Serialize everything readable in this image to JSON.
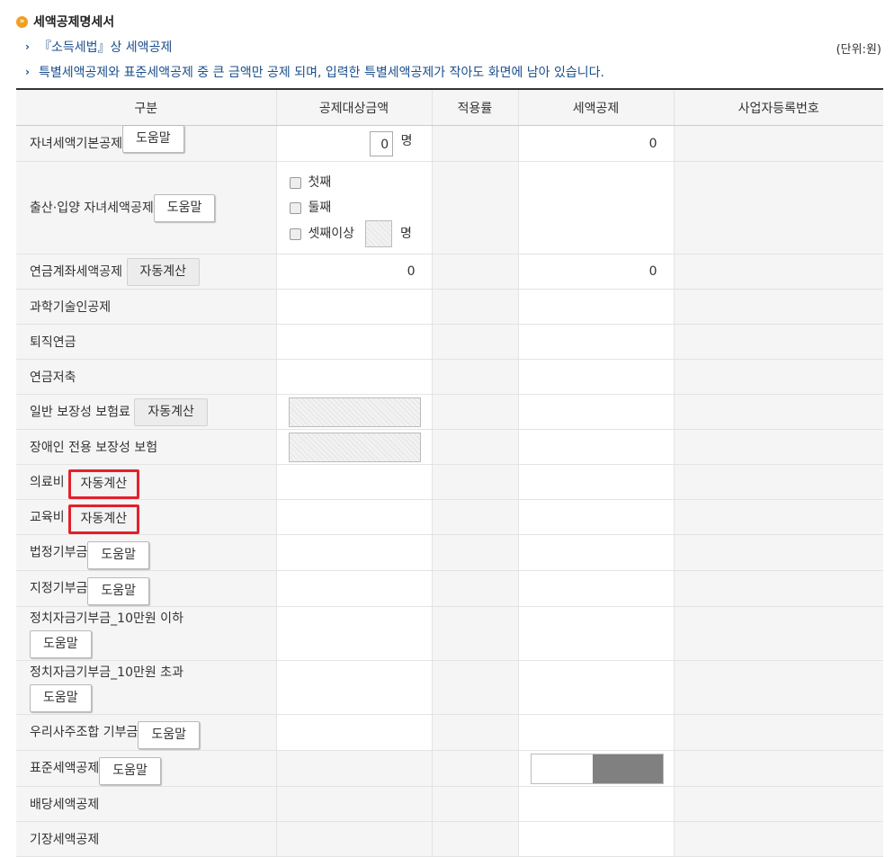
{
  "header": {
    "bullet": "»",
    "title": "세액공제명세서"
  },
  "notes": {
    "arrow": "›",
    "line1": "『소득세법』상 세액공제",
    "line2": "특별세액공제와 표준세액공제 중 큰 금액만 공제 되며, 입력한 특별세액공제가 작아도 화면에 남아 있습니다."
  },
  "unit": "(단위:원)",
  "columns": [
    "구분",
    "공제대상금액",
    "적용률",
    "세액공제",
    "사업자등록번호"
  ],
  "rows": {
    "child_basic": {
      "label": "자녀세액기본공제",
      "button": "도움말",
      "count": "0",
      "count_unit": "명",
      "credit": "0"
    },
    "birth_adoption": {
      "label": "출산·입양 자녀세액공제",
      "button": "도움말",
      "options": [
        "첫째",
        "둘째",
        "셋째이상"
      ],
      "count_unit": "명"
    },
    "pension_account": {
      "label": "연금계좌세액공제",
      "button": "자동계산",
      "amount": "0",
      "credit": "0"
    },
    "sci_tech": {
      "label": "과학기술인공제"
    },
    "retirement": {
      "label": "퇴직연금"
    },
    "pension_savings": {
      "label": "연금저축"
    },
    "general_insurance": {
      "label": "일반 보장성 보험료",
      "button": "자동계산"
    },
    "disabled_insurance": {
      "label": "장애인 전용 보장성 보험"
    },
    "medical": {
      "label": "의료비",
      "button": "자동계산"
    },
    "education": {
      "label": "교육비",
      "button": "자동계산"
    },
    "legal_donation": {
      "label": "법정기부금",
      "button": "도움말"
    },
    "designated_donation": {
      "label": "지정기부금",
      "button": "도움말"
    },
    "political_under": {
      "label": "정치자금기부금_10만원 이하",
      "button": "도움말"
    },
    "political_over": {
      "label": "정치자금기부금_10만원 초과",
      "button": "도움말"
    },
    "esop_donation": {
      "label": "우리사주조합 기부금",
      "button": "도움말"
    },
    "standard": {
      "label": "표준세액공제",
      "button": "도움말"
    },
    "dividend": {
      "label": "배당세액공제"
    },
    "bookkeeping": {
      "label": "기장세액공제"
    }
  },
  "colors": {
    "accent": "#1b4f8c",
    "highlight": "#e3202b",
    "bullet": "#f0a020"
  }
}
